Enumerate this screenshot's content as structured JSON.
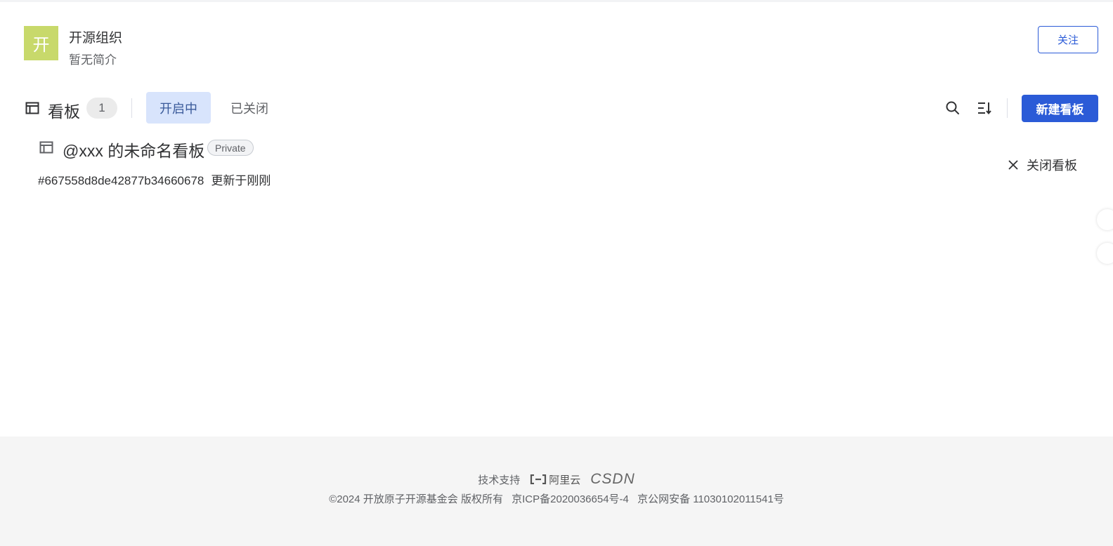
{
  "org": {
    "avatar_char": "开",
    "avatar_color": "#c8d96b",
    "name": "开源组织",
    "description": "暂无简介",
    "follow_label": "关注"
  },
  "toolbar": {
    "title": "看板",
    "count": "1",
    "tabs": [
      {
        "label": "开启中",
        "active": true
      },
      {
        "label": "已关闭",
        "active": false
      }
    ],
    "new_board_label": "新建看板",
    "accent_color": "#2b5bd7"
  },
  "boards": [
    {
      "name": "@xxx 的未命名看板",
      "visibility": "Private",
      "id": "#667558d8de42877b34660678",
      "updated": "更新于刚刚",
      "close_label": "关闭看板"
    }
  ],
  "footer": {
    "support_label": "技术支持",
    "aliyun_label": "阿里云",
    "csdn_label": "CSDN",
    "copyright": "©2024 开放原子开源基金会 版权所有",
    "icp": "京ICP备2020036654号-4",
    "police": "京公网安备 11030102011541号"
  }
}
